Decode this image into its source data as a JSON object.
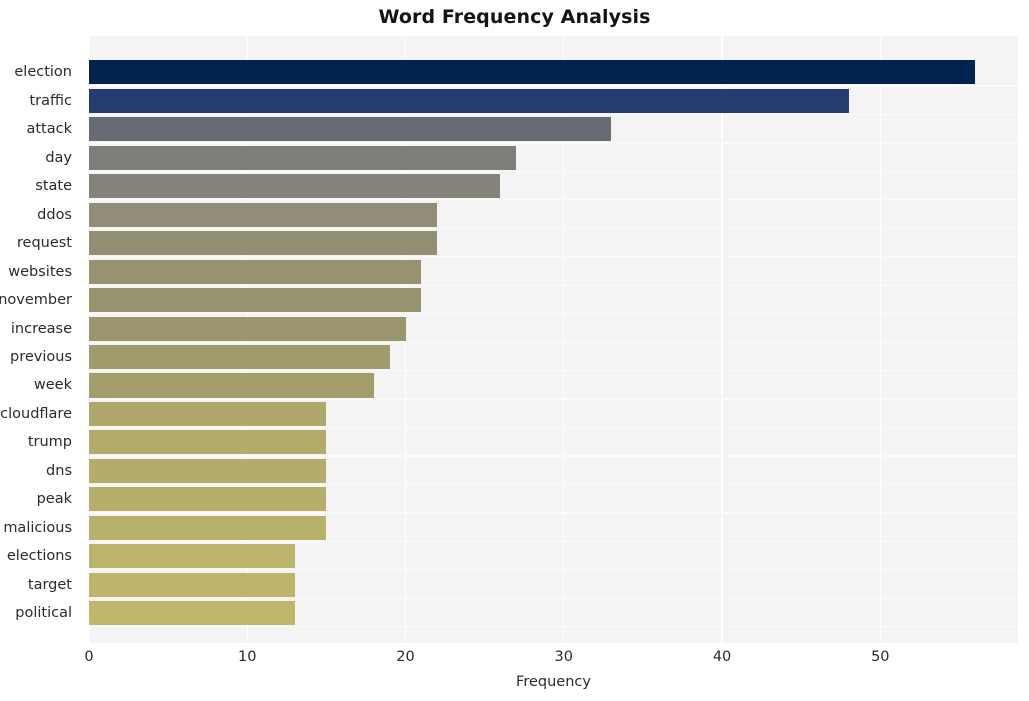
{
  "chart_data": {
    "type": "bar",
    "orientation": "horizontal",
    "title": "Word Frequency Analysis",
    "xlabel": "Frequency",
    "ylabel": "",
    "categories": [
      "election",
      "traffic",
      "attack",
      "day",
      "state",
      "ddos",
      "request",
      "websites",
      "november",
      "increase",
      "previous",
      "week",
      "cloudflare",
      "trump",
      "dns",
      "peak",
      "malicious",
      "elections",
      "target",
      "political"
    ],
    "values": [
      56,
      48,
      33,
      27,
      26,
      22,
      22,
      21,
      21,
      20,
      19,
      18,
      15,
      15,
      15,
      15,
      15,
      13,
      13,
      13
    ],
    "bar_colors": [
      "#002350",
      "#243c6e",
      "#666a73",
      "#7d7e79",
      "#85827b",
      "#918d76",
      "#938f74",
      "#979272",
      "#999470",
      "#9c966e",
      "#a09a6d",
      "#a39d6c",
      "#b0a86b",
      "#b3aa6b",
      "#b5ac6b",
      "#b7ae6b",
      "#b9b06a",
      "#bdb36a",
      "#bfb56a",
      "#c1b76a"
    ],
    "xlim": [
      0,
      58.7
    ],
    "xticks": [
      0,
      10,
      20,
      30,
      40,
      50
    ],
    "xtick_labels": [
      "0",
      "10",
      "20",
      "30",
      "40",
      "50"
    ],
    "grid": true,
    "grid_axis": "both",
    "legend": null,
    "plot_background": "#f4f4f5",
    "figure_background": "#ffffff",
    "grid_color": "#ffffff"
  }
}
